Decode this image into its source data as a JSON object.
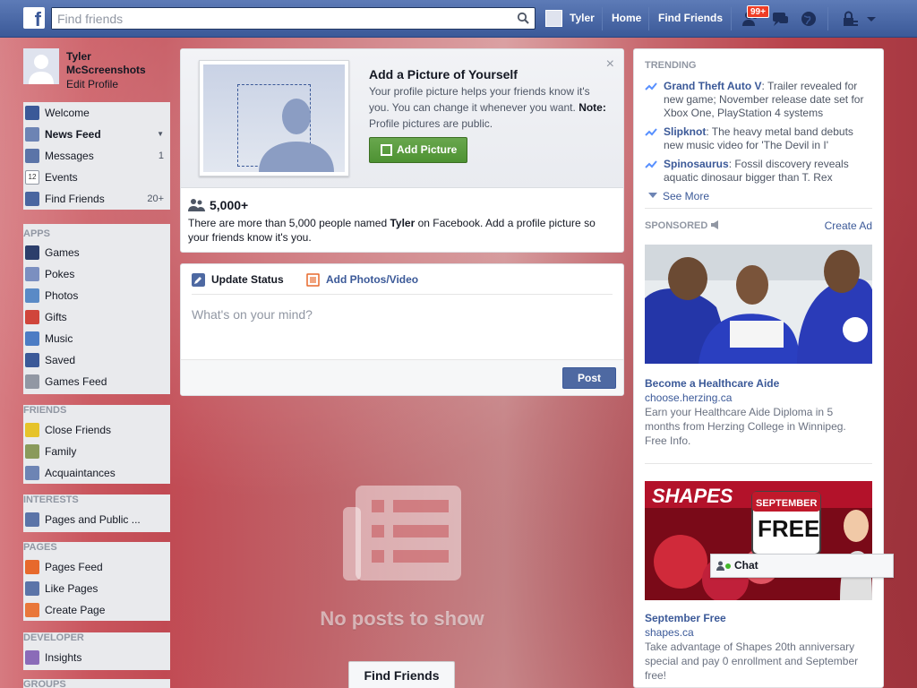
{
  "topbar": {
    "logo": "f",
    "search_placeholder": "Find friends",
    "user_name": "Tyler",
    "home": "Home",
    "find_friends": "Find Friends",
    "friend_requests_badge": "99+"
  },
  "profile": {
    "name": "Tyler McScreenshots",
    "edit_label": "Edit Profile"
  },
  "nav": {
    "main": [
      {
        "label": "Welcome",
        "icon": "welcome-icon",
        "count": ""
      },
      {
        "label": "News Feed",
        "icon": "news-feed-icon",
        "count": ""
      },
      {
        "label": "Messages",
        "icon": "messages-icon",
        "count": "1"
      },
      {
        "label": "Events",
        "icon": "events-icon",
        "count": ""
      },
      {
        "label": "Find Friends",
        "icon": "find-friends-icon",
        "count": "20+"
      }
    ],
    "apps_header": "APPS",
    "apps": [
      "Games",
      "Pokes",
      "Photos",
      "Gifts",
      "Music",
      "Saved",
      "Games Feed"
    ],
    "friends_header": "FRIENDS",
    "friends": [
      "Close Friends",
      "Family",
      "Acquaintances"
    ],
    "interests_header": "INTERESTS",
    "interests": [
      "Pages and Public ..."
    ],
    "pages_header": "PAGES",
    "pages": [
      "Pages Feed",
      "Like Pages",
      "Create Page"
    ],
    "developer_header": "DEVELOPER",
    "developer": [
      "Insights"
    ],
    "groups_header": "GROUPS"
  },
  "addpicture": {
    "title": "Add a Picture of Yourself",
    "text": "Your profile picture helps your friends know it's you. You can change it whenever you want.",
    "note_label": "Note:",
    "note_text": " Profile pictures are public.",
    "button": "Add Picture",
    "close": "×",
    "count": "5,000+",
    "desc_before": "There are more than 5,000 people named ",
    "desc_name": "Tyler",
    "desc_after": " on Facebook. Add a profile picture so your friends know it's you."
  },
  "composer": {
    "tab_status": "Update Status",
    "tab_photos": "Add Photos/Video",
    "placeholder": "What's on your mind?",
    "post_button": "Post"
  },
  "feed": {
    "empty_text": "No posts to show",
    "find_friends_button": "Find Friends"
  },
  "trending": {
    "header": "TRENDING",
    "items": [
      {
        "title": "Grand Theft Auto V",
        "text": ": Trailer revealed for new game; November release date set for Xbox One, PlayStation 4 systems"
      },
      {
        "title": "Slipknot",
        "text": ": The heavy metal band debuts new music video for 'The Devil in I'"
      },
      {
        "title": "Spinosaurus",
        "text": ": Fossil discovery reveals aquatic dinosaur bigger than T. Rex"
      }
    ],
    "see_more": "See More"
  },
  "sponsored": {
    "header": "SPONSORED",
    "create_ad": "Create Ad",
    "ads": [
      {
        "title": "Become a Healthcare Aide",
        "domain": "choose.herzing.ca",
        "text": "Earn your Healthcare Aide Diploma in 5 months from Herzing College in Winnipeg. Free Info.",
        "image_text": ""
      },
      {
        "title": "September Free",
        "domain": "shapes.ca",
        "text": "Take advantage of Shapes 20th anniversary special and pay 0 enrollment and September free!",
        "image_text_1": "SHAPES",
        "image_text_2": "SEPTEMBER",
        "image_text_3": "FREE"
      }
    ]
  },
  "chat": {
    "label": "Chat"
  },
  "colors": {
    "brand": "#3b5998",
    "green_button": "#4e9233",
    "badge": "#f03d25"
  }
}
